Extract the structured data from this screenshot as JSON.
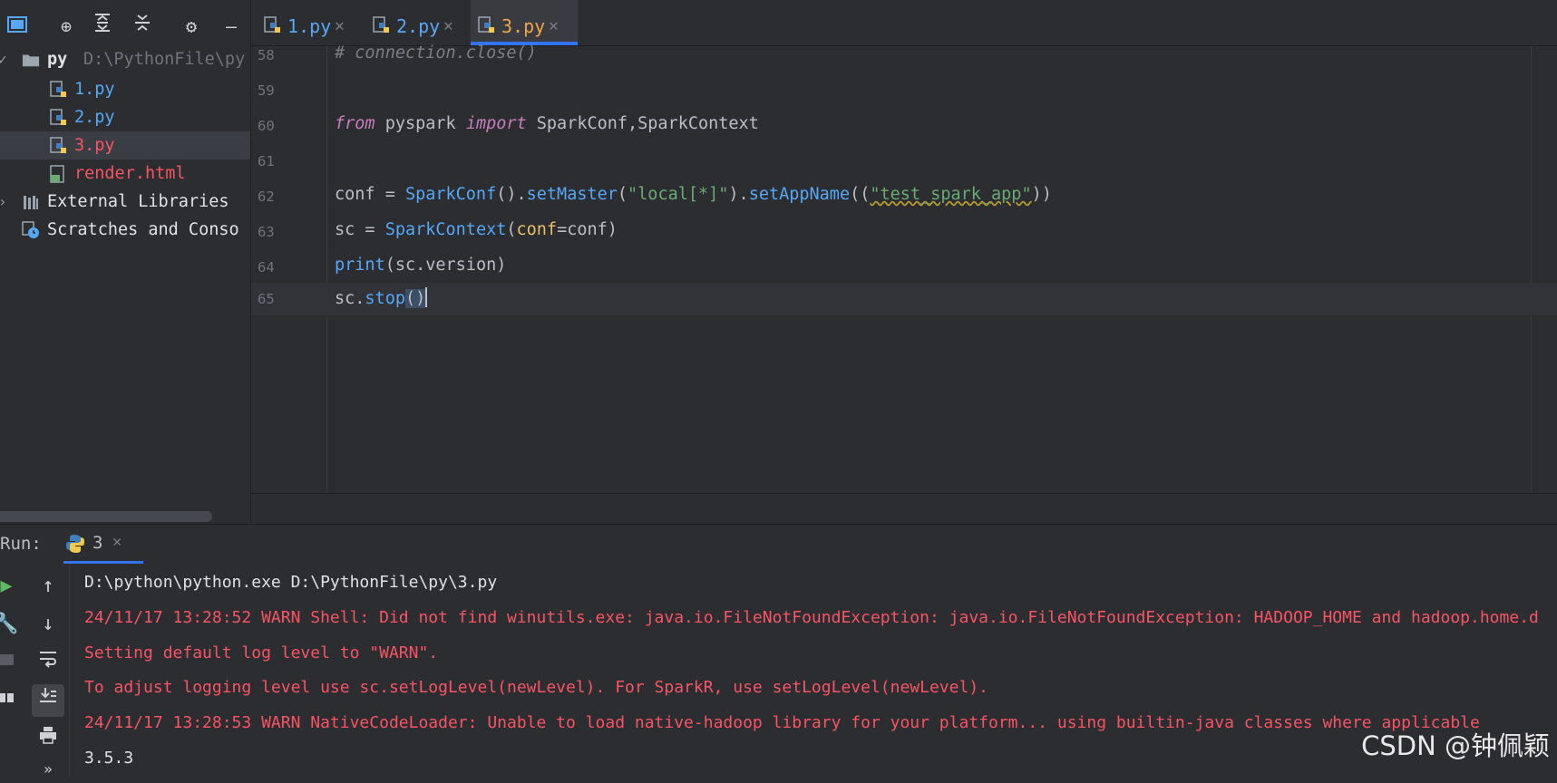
{
  "project": {
    "root_name": "py",
    "root_path": "D:\\PythonFile\\py",
    "files": [
      {
        "label": "1.py",
        "color": "#56a8f5"
      },
      {
        "label": "2.py",
        "color": "#56a8f5"
      },
      {
        "label": "3.py",
        "color": "#f75464"
      },
      {
        "label": "render.html",
        "color": "#f75464"
      }
    ],
    "external_libraries": "External Libraries",
    "scratches": "Scratches and Conso"
  },
  "tabs": [
    {
      "label": "1.py",
      "color": "#56a8f5"
    },
    {
      "label": "2.py",
      "color": "#56a8f5"
    },
    {
      "label": "3.py",
      "color": "#f0a44b"
    }
  ],
  "editor": {
    "line_numbers": [
      "58",
      "59",
      "60",
      "61",
      "62",
      "63",
      "64",
      "65"
    ],
    "line58_comment": "# connection.close()",
    "line60": {
      "from": "from",
      "mod": " pyspark ",
      "imp": "import",
      "names": " SparkConf,SparkContext"
    },
    "line62": {
      "a": "conf = ",
      "cls": "SparkConf",
      "b": "().",
      "m1": "setMaster",
      "c": "(",
      "s1": "\"local[*]\"",
      "d": ").",
      "m2": "setAppName",
      "e": "((",
      "s2": "\"test_spark_app\"",
      "f": "))"
    },
    "line63": {
      "a": "sc = ",
      "cls": "SparkContext",
      "b": "(",
      "p": "conf",
      "c": "=conf)"
    },
    "line64": {
      "fn": "print",
      "a": "(sc.version)"
    },
    "line65": {
      "a": "sc.",
      "fn": "stop",
      "b": "()"
    }
  },
  "run": {
    "label": "Run:",
    "tab_label": "3",
    "console": [
      "D:\\python\\python.exe D:\\PythonFile\\py\\3.py",
      "24/11/17 13:28:52 WARN Shell: Did not find winutils.exe: java.io.FileNotFoundException: java.io.FileNotFoundException: HADOOP_HOME and hadoop.home.d",
      "Setting default log level to \"WARN\".",
      "To adjust logging level use sc.setLogLevel(newLevel). For SparkR, use setLogLevel(newLevel).",
      "24/11/17 13:28:53 WARN NativeCodeLoader: Unable to load native-hadoop library for your platform... using builtin-java classes where applicable",
      "3.5.3"
    ]
  },
  "watermark": "CSDN @钟佩颖"
}
